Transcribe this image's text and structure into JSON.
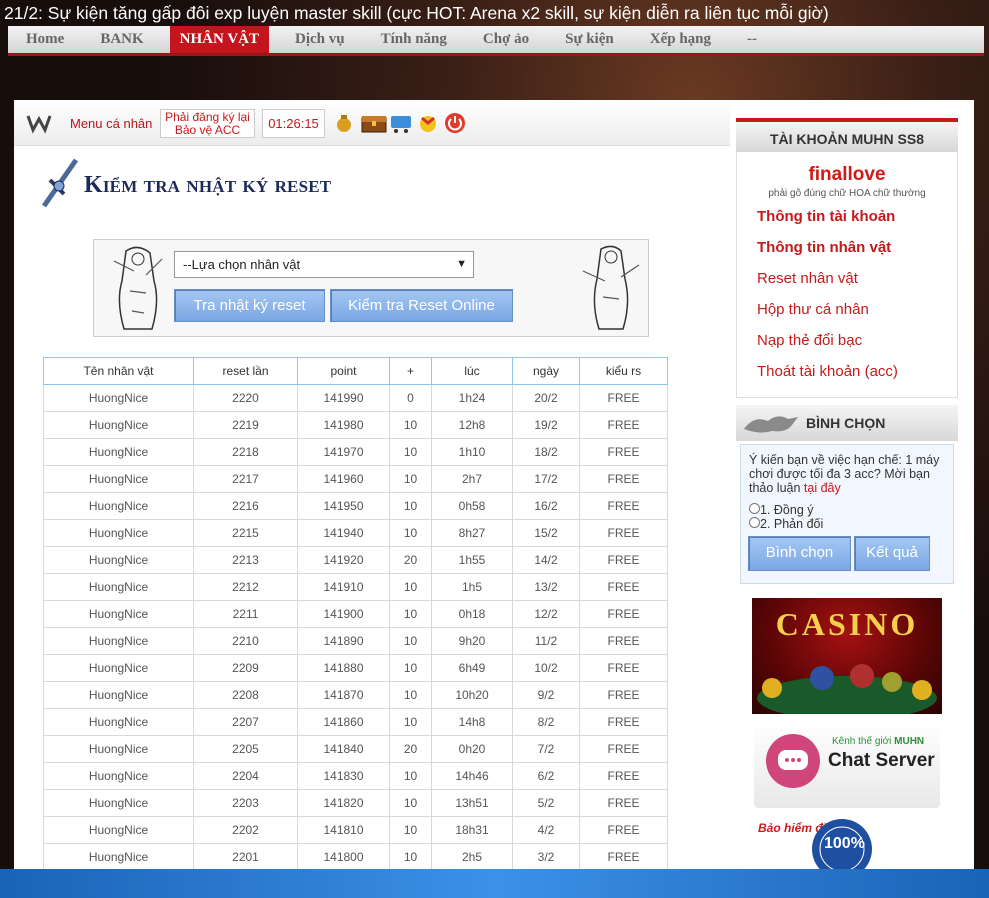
{
  "announcement": "21/2: Sự kiện tăng gấp đôi exp luyện master skill (cực HOT: Arena x2 skill, sự kiện diễn ra liên tục mỗi giờ)",
  "nav": [
    "Home",
    "BANK",
    "NHÂN VẬT",
    "Dịch vụ",
    "Tính năng",
    "Chợ ảo",
    "Sự kiện",
    "Xếp hạng",
    "--"
  ],
  "nav_active": "NHÂN VẬT",
  "toolbar": {
    "menu_label": "Menu cá nhân",
    "warning_line1": "Phải đăng ký lại",
    "warning_line2": "Bảo vệ ACC",
    "timer": "01:26:15",
    "icons": [
      "money-bag-icon",
      "treasure-chest-icon",
      "shopping-cart-icon",
      "gift-icon",
      "power-icon"
    ]
  },
  "page_title": "Kiểm tra nhật ký reset",
  "character_select": {
    "selected": "--Lựa chọn nhân vật"
  },
  "buttons": {
    "check_reset_log": "Tra nhật ký reset",
    "check_reset_online": "Kiểm tra Reset Online"
  },
  "table": {
    "columns": [
      "Tên nhân vật",
      "reset lần",
      "point",
      "+",
      "lúc",
      "ngày",
      "kiểu rs"
    ],
    "rows": [
      [
        "HuongNice",
        "2220",
        "141990",
        "0",
        "1h24",
        "20/2",
        "FREE"
      ],
      [
        "HuongNice",
        "2219",
        "141980",
        "10",
        "12h8",
        "19/2",
        "FREE"
      ],
      [
        "HuongNice",
        "2218",
        "141970",
        "10",
        "1h10",
        "18/2",
        "FREE"
      ],
      [
        "HuongNice",
        "2217",
        "141960",
        "10",
        "2h7",
        "17/2",
        "FREE"
      ],
      [
        "HuongNice",
        "2216",
        "141950",
        "10",
        "0h58",
        "16/2",
        "FREE"
      ],
      [
        "HuongNice",
        "2215",
        "141940",
        "10",
        "8h27",
        "15/2",
        "FREE"
      ],
      [
        "HuongNice",
        "2213",
        "141920",
        "20",
        "1h55",
        "14/2",
        "FREE"
      ],
      [
        "HuongNice",
        "2212",
        "141910",
        "10",
        "1h5",
        "13/2",
        "FREE"
      ],
      [
        "HuongNice",
        "2211",
        "141900",
        "10",
        "0h18",
        "12/2",
        "FREE"
      ],
      [
        "HuongNice",
        "2210",
        "141890",
        "10",
        "9h20",
        "11/2",
        "FREE"
      ],
      [
        "HuongNice",
        "2209",
        "141880",
        "10",
        "6h49",
        "10/2",
        "FREE"
      ],
      [
        "HuongNice",
        "2208",
        "141870",
        "10",
        "10h20",
        "9/2",
        "FREE"
      ],
      [
        "HuongNice",
        "2207",
        "141860",
        "10",
        "14h8",
        "8/2",
        "FREE"
      ],
      [
        "HuongNice",
        "2205",
        "141840",
        "20",
        "0h20",
        "7/2",
        "FREE"
      ],
      [
        "HuongNice",
        "2204",
        "141830",
        "10",
        "14h46",
        "6/2",
        "FREE"
      ],
      [
        "HuongNice",
        "2203",
        "141820",
        "10",
        "13h51",
        "5/2",
        "FREE"
      ],
      [
        "HuongNice",
        "2202",
        "141810",
        "10",
        "18h31",
        "4/2",
        "FREE"
      ],
      [
        "HuongNice",
        "2201",
        "141800",
        "10",
        "2h5",
        "3/2",
        "FREE"
      ]
    ]
  },
  "account": {
    "header": "TÀI KHOẢN MUHN SS8",
    "username": "finallove",
    "hint": "phải gõ đúng chữ HOA chữ thường",
    "links": [
      "Thông tin tài khoản",
      "Thông tin nhân vật",
      "Reset nhân vật",
      "Hộp thư cá nhân",
      "Nạp thẻ đổi bạc",
      "Thoát tài khoản (acc)"
    ]
  },
  "poll": {
    "header": "BÌNH CHỌN",
    "question": "Ý kiến bạn về việc hạn chế: 1 máy chơi được tối đa 3 acc? Mời bạn thảo luận",
    "question_link": "tại đây",
    "options": [
      "1. Đồng ý",
      "2. Phản đối"
    ],
    "vote_button": "Bình chọn",
    "result_button": "Kết quả"
  },
  "banners": {
    "casino": "CASINO",
    "chat_sub": "Kênh thế giới",
    "chat_brand": "MUHN",
    "chat_title": "Chat Server",
    "insurance": "Bảo hiểm đồ",
    "guarantee": "100%"
  },
  "colors": {
    "accent": "#c41a1a",
    "nav_active": "#c4141d",
    "button": "#7ba6e3",
    "table_header_border": "#8ec8e8"
  }
}
